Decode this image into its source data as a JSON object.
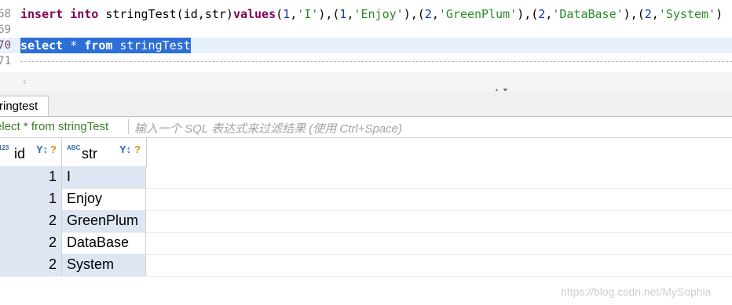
{
  "editor": {
    "lines": [
      {
        "num": "68",
        "parts": [
          {
            "text": "insert",
            "cls": "kw"
          },
          {
            "text": " "
          },
          {
            "text": "into",
            "cls": "kw"
          },
          {
            "text": " stringTest(id,str)"
          },
          {
            "text": "values",
            "cls": "kw"
          },
          {
            "text": "("
          },
          {
            "text": "1",
            "cls": "num"
          },
          {
            "text": ","
          },
          {
            "text": "'I'",
            "cls": "str"
          },
          {
            "text": "),("
          },
          {
            "text": "1",
            "cls": "num"
          },
          {
            "text": ","
          },
          {
            "text": "'Enjoy'",
            "cls": "str"
          },
          {
            "text": "),("
          },
          {
            "text": "2",
            "cls": "num"
          },
          {
            "text": ","
          },
          {
            "text": "'GreenPlum'",
            "cls": "str"
          },
          {
            "text": "),("
          },
          {
            "text": "2",
            "cls": "num"
          },
          {
            "text": ","
          },
          {
            "text": "'DataBase'",
            "cls": "str"
          },
          {
            "text": "),("
          },
          {
            "text": "2",
            "cls": "num"
          },
          {
            "text": ","
          },
          {
            "text": "'System'",
            "cls": "str"
          },
          {
            "text": ")"
          }
        ]
      },
      {
        "num": "69",
        "parts": []
      },
      {
        "num": "70",
        "active": true,
        "parts": [
          {
            "text": "select",
            "cls": "kw"
          },
          {
            "text": " * "
          },
          {
            "text": "from",
            "cls": "kw"
          },
          {
            "text": " stringTest"
          }
        ]
      },
      {
        "num": "71",
        "parts": []
      }
    ]
  },
  "result_tab": {
    "label": "ringtest"
  },
  "filter": {
    "query": "elect * from stringTest",
    "placeholder": "输入一个 SQL 表达式来过滤结果 (使用 Ctrl+Space)"
  },
  "grid": {
    "columns": [
      {
        "type_icon": "123",
        "name": "id"
      },
      {
        "type_icon": "ABC",
        "name": "str"
      }
    ],
    "filter_icon": "filter-sort-icon",
    "rows": [
      {
        "id": "1",
        "str": "I"
      },
      {
        "id": "1",
        "str": "Enjoy"
      },
      {
        "id": "2",
        "str": "GreenPlum"
      },
      {
        "id": "2",
        "str": "DataBase"
      },
      {
        "id": "2",
        "str": "System"
      }
    ]
  },
  "icons": {
    "left_arrow": "‹",
    "sort_arrows": "▲▼",
    "filter": "Y↕",
    "question": "?"
  },
  "watermark": "https://blog.csdn.net/MySophia"
}
